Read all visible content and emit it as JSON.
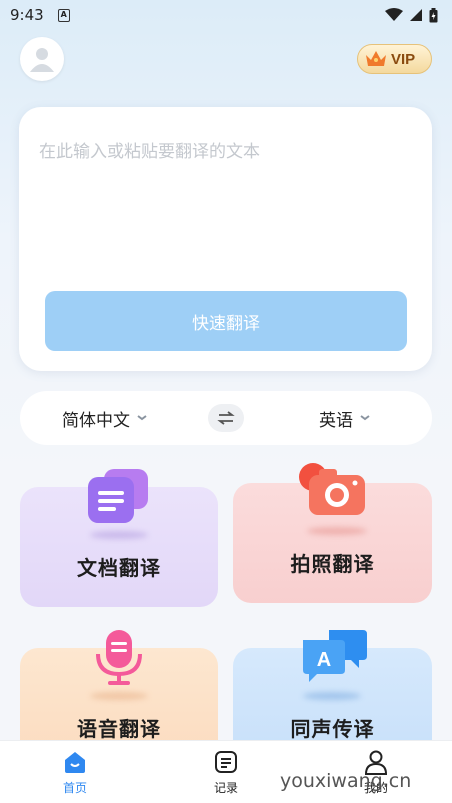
{
  "status": {
    "time": "9:43",
    "a_icon": "A"
  },
  "header": {
    "vip_label": "VIP"
  },
  "input": {
    "placeholder": "在此输入或粘贴要翻译的文本",
    "value": ""
  },
  "translate_button": "快速翻译",
  "languages": {
    "source": "简体中文",
    "target": "英语"
  },
  "features": [
    {
      "label": "文档翻译",
      "icon": "document-icon",
      "bg": "#e7ddfa"
    },
    {
      "label": "拍照翻译",
      "icon": "camera-icon",
      "bg": "#fad7d7"
    },
    {
      "label": "语音翻译",
      "icon": "microphone-icon",
      "bg": "#fde3c7"
    },
    {
      "label": "同声传译",
      "icon": "chat-bubble-icon",
      "bg": "#d3e8fc"
    }
  ],
  "nav": [
    {
      "label": "首页",
      "icon": "home-icon",
      "active": true
    },
    {
      "label": "记录",
      "icon": "record-icon",
      "active": false
    },
    {
      "label": "我的",
      "icon": "user-icon",
      "active": false
    }
  ],
  "watermark": "youxiwang.cn",
  "colors": {
    "accent": "#2f88f0",
    "button": "#9ecff6"
  }
}
